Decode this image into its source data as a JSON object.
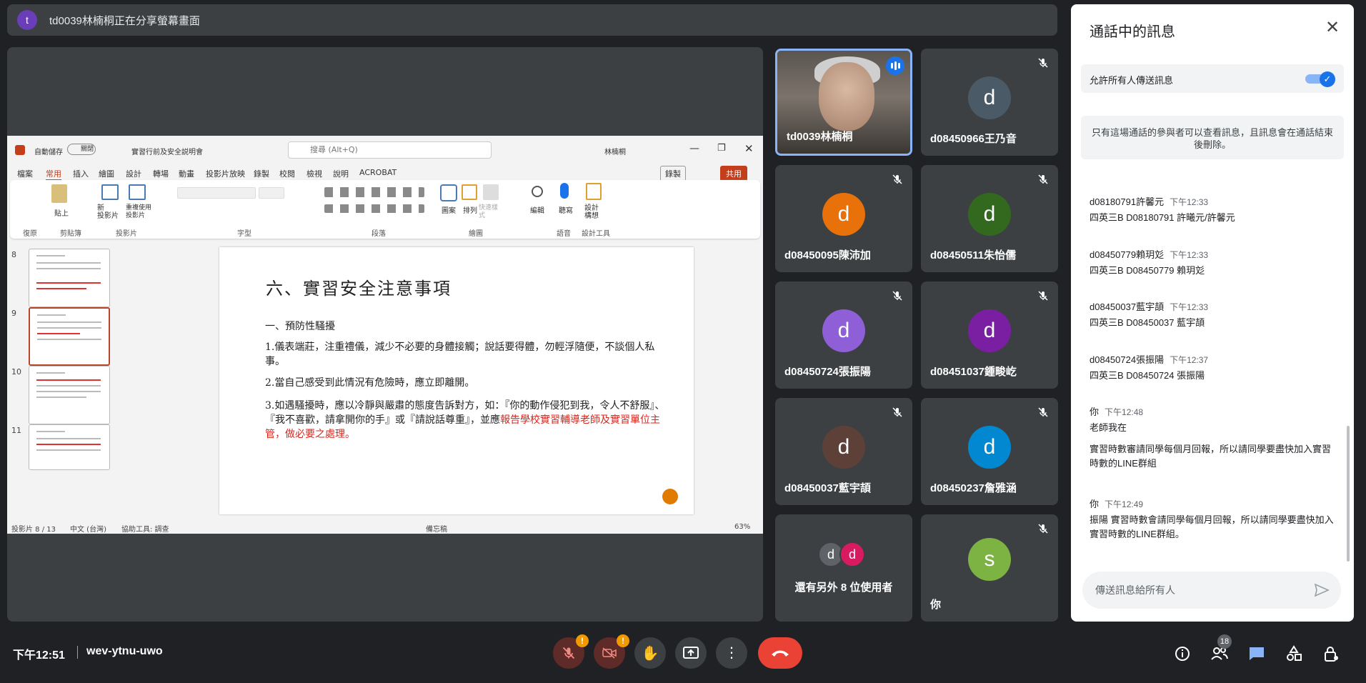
{
  "presenter_bar": {
    "avatar_letter": "t",
    "text": "td0039林楠桐正在分享螢幕畫面"
  },
  "ppt": {
    "autosave": "自動儲存",
    "autosave_state": "關閉",
    "filename": "實習行前及安全説明會",
    "search_placeholder": "搜尋 (Alt+Q)",
    "user": "林楠桐",
    "tabs": [
      "檔案",
      "常用",
      "插入",
      "繪圖",
      "設計",
      "轉場",
      "動畫",
      "投影片放映",
      "錄製",
      "校閱",
      "檢視",
      "說明",
      "ACROBAT"
    ],
    "record_btn": "錄製",
    "share_btn": "共用",
    "groups": [
      "復原",
      "剪貼簿",
      "投影片",
      "字型",
      "段落",
      "繪圖",
      "語音",
      "設計工具"
    ],
    "ribbon_buttons": {
      "paste": "貼上",
      "new_slide": "新\n投影片",
      "reuse": "重複使用投影片",
      "shapes": "圖案",
      "arrange": "排列",
      "quick_styles": "快速樣式",
      "edit": "編輯",
      "dictate": "聽寫",
      "designer": "設計\n構想"
    },
    "thumb_numbers": [
      "8",
      "9",
      "10",
      "11"
    ],
    "slide": {
      "title": "六、實習安全注意事項",
      "sub": "一、預防性騷擾",
      "p1": "1.儀表端莊，注重禮儀，減少不必要的身體接觸；說話要得體，勿輕浮隨便，不談個人私事。",
      "p2": "2.當自己感受到此情況有危險時，應立即離開。",
      "p3a": "3.如遇騷擾時，應以冷靜與嚴肅的態度告訴對方，如：『你的動作侵犯到我，令人不舒服』、『我不喜歡，請拿開你的手』或『請說話尊重』，並應",
      "p3b": "報告學校實習輔導老師及實習單位主管，做必要之處理。"
    },
    "status": {
      "slide_count": "投影片 8 / 13",
      "lang": "中文 (台灣)",
      "access": "協助工具: 調查",
      "notes": "備忘稿",
      "zoom": "63%"
    }
  },
  "tiles": [
    {
      "name": "td0039林楠桐",
      "speaking": true
    },
    {
      "name": "d08450966王乃音",
      "letter": "d",
      "color": "#4a5a66"
    },
    {
      "name": "d08450095陳沛加",
      "letter": "d",
      "color": "#e8710a"
    },
    {
      "name": "d08450511朱怡儒",
      "letter": "d",
      "color": "#33691e"
    },
    {
      "name": "d08450724張振陽",
      "letter": "d",
      "color": "#8e5fd6"
    },
    {
      "name": "d08451037鍾畯屹",
      "letter": "d",
      "color": "#7b1fa2"
    },
    {
      "name": "d08450037藍宇頡",
      "letter": "d",
      "color": "#5d4037"
    },
    {
      "name": "d08450237詹雅涵",
      "letter": "d",
      "color": "#0288d1"
    },
    {
      "name": "還有另外 8 位使用者",
      "letters": [
        "d",
        "d"
      ]
    },
    {
      "name": "你",
      "letter": "s",
      "color": "#7cb342"
    }
  ],
  "chat": {
    "title": "通話中的訊息",
    "allow_label": "允許所有人傳送訊息",
    "notice": "只有這場通話的參與者可以查看訊息，且訊息會在通話結束後刪除。",
    "messages": [
      {
        "sender": "d08180791許馨元",
        "time": "下午12:33",
        "text": "四英三B D08180791 許曦元/許馨元"
      },
      {
        "sender": "d08450779賴玥彣",
        "time": "下午12:33",
        "text": "四英三B D08450779 賴玥彣"
      },
      {
        "sender": "d08450037藍宇頡",
        "time": "下午12:33",
        "text": "四英三B D08450037 藍宇頡"
      },
      {
        "sender": "d08450724張振陽",
        "time": "下午12:37",
        "text": "四英三B D08450724 張振陽"
      },
      {
        "sender": "你",
        "time": "下午12:48",
        "text": "老師我在",
        "text2": "實習時數審請同學每個月回報，所以請同學要盡快加入實習時數的LINE群組"
      },
      {
        "sender": "你",
        "time": "下午12:49",
        "text": "振陽  實習時數會請同學每個月回報，所以請同學要盡快加入實習時數的LINE群組。"
      }
    ],
    "input_placeholder": "傳送訊息給所有人"
  },
  "bottom": {
    "time": "下午12:51",
    "meeting_code": "wev-ytnu-uwo",
    "participants_count": "18"
  },
  "colors": {
    "accent": "#1a73e8",
    "end_call": "#ea4335",
    "warning": "#f29900"
  }
}
